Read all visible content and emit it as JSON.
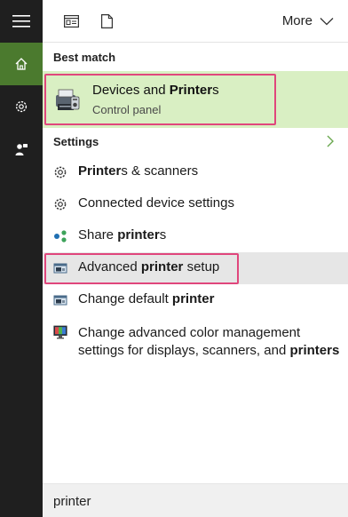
{
  "topbar": {
    "more_label": "More"
  },
  "best_match": {
    "heading": "Best match",
    "title_pre": "Devices and ",
    "title_bold": "Printer",
    "title_post": "s",
    "subtitle": "Control panel"
  },
  "settings": {
    "heading": "Settings",
    "items": [
      {
        "pre": "",
        "bold": "Printer",
        "post": "s & scanners"
      },
      {
        "pre": "Connected device settings",
        "bold": "",
        "post": ""
      },
      {
        "pre": "Share ",
        "bold": "printer",
        "post": "s"
      },
      {
        "pre": "Advanced ",
        "bold": "printer",
        "post": " setup"
      },
      {
        "pre": "Change default ",
        "bold": "printer",
        "post": ""
      }
    ],
    "multiline_item": {
      "line1": "Change advanced color management",
      "line2_pre": "settings for displays, scanners, and ",
      "line2_bold": "printers"
    }
  },
  "search": {
    "value": "printer"
  },
  "colors": {
    "accent": "#4b7a2e",
    "highlight": "#d9efc3",
    "outline": "#e0467c"
  }
}
